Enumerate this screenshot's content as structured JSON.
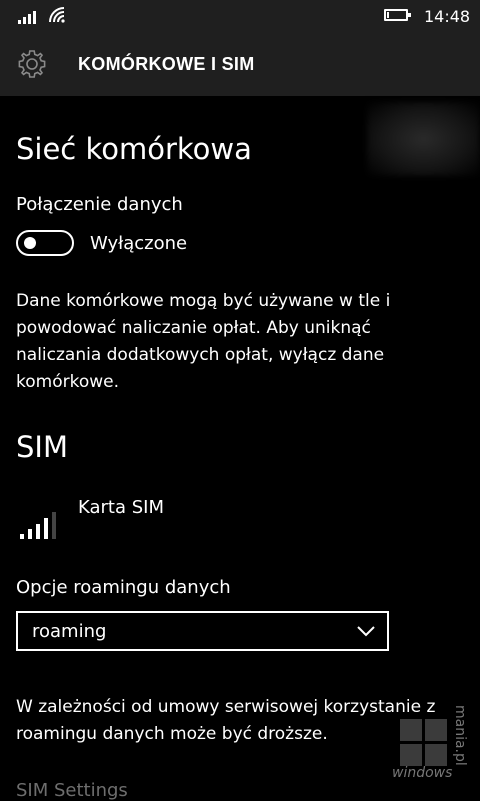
{
  "status_bar": {
    "time": "14:48",
    "icons": [
      "signal-icon",
      "wifi-icon",
      "battery-icon"
    ]
  },
  "header": {
    "icon": "gear-icon",
    "title": "KOMÓRKOWE I SIM"
  },
  "cellular": {
    "section_title": "Sieć komórkowa",
    "data_connection_label": "Połączenie danych",
    "toggle_state": "Wyłączone",
    "toggle_on": false,
    "description": "Dane komórkowe mogą być używane w tle i powodować naliczanie opłat. Aby uniknąć naliczania dodatkowych opłat, wyłącz dane komórkowe."
  },
  "sim": {
    "section_title": "SIM",
    "card_name": "Karta SIM",
    "signal_bars": 4,
    "signal_bars_total": 5,
    "roaming_label": "Opcje roamingu danych",
    "roaming_value": "roaming",
    "roaming_description": "W zależności od umowy serwisowej korzystanie z roamingu danych może być droższe.",
    "settings_link": "SIM Settings"
  },
  "watermark": {
    "text_1": "windows",
    "text_2": "mania.pl"
  },
  "colors": {
    "background": "#000000",
    "header_background": "#1f1f1f",
    "text": "#ffffff",
    "muted_text": "#6e6e6e"
  }
}
